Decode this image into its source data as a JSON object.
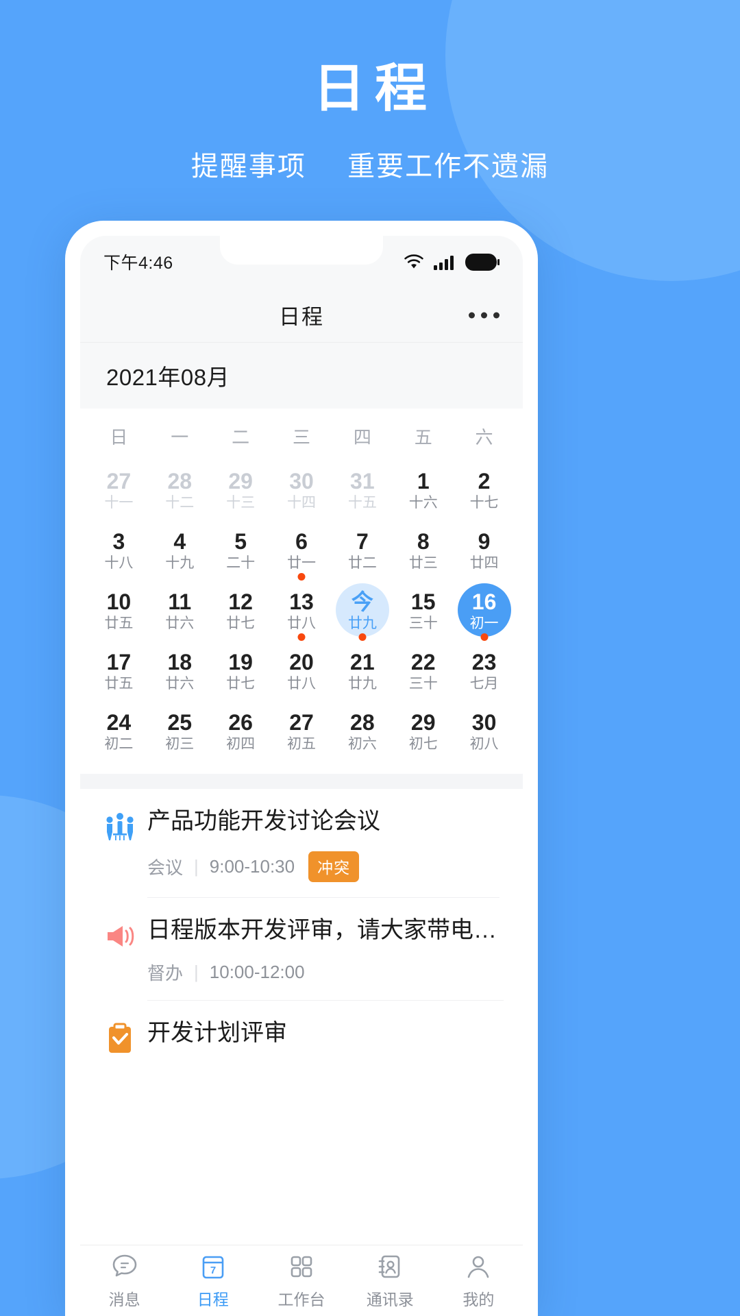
{
  "hero": {
    "title": "日程",
    "subtitle_left": "提醒事项",
    "subtitle_right": "重要工作不遗漏"
  },
  "colors": {
    "brand_blue": "#55A4FB",
    "accent_blue": "#4A9EF5",
    "today_bg": "#D6E9FD",
    "dot_red": "#F8480E",
    "badge_orange": "#F0922B"
  },
  "statusbar": {
    "time": "下午4:46",
    "wifi_icon": "wifi-icon",
    "signal_icon": "cellular-signal-icon",
    "battery_icon": "battery-icon"
  },
  "navbar": {
    "title": "日程",
    "more_icon": "more-horizontal-icon"
  },
  "calendar": {
    "month_label": "2021年08月",
    "weekdays": [
      "日",
      "一",
      "二",
      "三",
      "四",
      "五",
      "六"
    ],
    "weeks": [
      [
        {
          "num": "27",
          "lunar": "十一",
          "muted": true,
          "dot": false
        },
        {
          "num": "28",
          "lunar": "十二",
          "muted": true,
          "dot": false
        },
        {
          "num": "29",
          "lunar": "十三",
          "muted": true,
          "dot": false
        },
        {
          "num": "30",
          "lunar": "十四",
          "muted": true,
          "dot": false
        },
        {
          "num": "31",
          "lunar": "十五",
          "muted": true,
          "dot": false
        },
        {
          "num": "1",
          "lunar": "十六",
          "muted": false,
          "dot": false
        },
        {
          "num": "2",
          "lunar": "十七",
          "muted": false,
          "dot": false
        }
      ],
      [
        {
          "num": "3",
          "lunar": "十八",
          "muted": false,
          "dot": false
        },
        {
          "num": "4",
          "lunar": "十九",
          "muted": false,
          "dot": false
        },
        {
          "num": "5",
          "lunar": "二十",
          "muted": false,
          "dot": false
        },
        {
          "num": "6",
          "lunar": "廿一",
          "muted": false,
          "dot": true
        },
        {
          "num": "7",
          "lunar": "廿二",
          "muted": false,
          "dot": false
        },
        {
          "num": "8",
          "lunar": "廿三",
          "muted": false,
          "dot": false
        },
        {
          "num": "9",
          "lunar": "廿四",
          "muted": false,
          "dot": false
        }
      ],
      [
        {
          "num": "10",
          "lunar": "廿五",
          "muted": false,
          "dot": false
        },
        {
          "num": "11",
          "lunar": "廿六",
          "muted": false,
          "dot": false
        },
        {
          "num": "12",
          "lunar": "廿七",
          "muted": false,
          "dot": false
        },
        {
          "num": "13",
          "lunar": "廿八",
          "muted": false,
          "dot": true
        },
        {
          "num": "今",
          "lunar": "廿九",
          "muted": false,
          "dot": true,
          "today": true
        },
        {
          "num": "15",
          "lunar": "三十",
          "muted": false,
          "dot": false
        },
        {
          "num": "16",
          "lunar": "初一",
          "muted": false,
          "dot": true,
          "selected": true
        }
      ],
      [
        {
          "num": "17",
          "lunar": "廿五",
          "muted": false,
          "dot": false
        },
        {
          "num": "18",
          "lunar": "廿六",
          "muted": false,
          "dot": false
        },
        {
          "num": "19",
          "lunar": "廿七",
          "muted": false,
          "dot": false
        },
        {
          "num": "20",
          "lunar": "廿八",
          "muted": false,
          "dot": false
        },
        {
          "num": "21",
          "lunar": "廿九",
          "muted": false,
          "dot": false
        },
        {
          "num": "22",
          "lunar": "三十",
          "muted": false,
          "dot": false
        },
        {
          "num": "23",
          "lunar": "七月",
          "muted": false,
          "dot": false
        }
      ],
      [
        {
          "num": "24",
          "lunar": "初二",
          "muted": false,
          "dot": false
        },
        {
          "num": "25",
          "lunar": "初三",
          "muted": false,
          "dot": false
        },
        {
          "num": "26",
          "lunar": "初四",
          "muted": false,
          "dot": false
        },
        {
          "num": "27",
          "lunar": "初五",
          "muted": false,
          "dot": false
        },
        {
          "num": "28",
          "lunar": "初六",
          "muted": false,
          "dot": false
        },
        {
          "num": "29",
          "lunar": "初七",
          "muted": false,
          "dot": false
        },
        {
          "num": "30",
          "lunar": "初八",
          "muted": false,
          "dot": false
        }
      ]
    ]
  },
  "events": [
    {
      "icon": "meeting-people-icon",
      "title": "产品功能开发讨论会议",
      "category": "会议",
      "time": "9:00-10:30",
      "badge": "冲突"
    },
    {
      "icon": "megaphone-icon",
      "title": "日程版本开发评审，请大家带电脑…",
      "category": "督办",
      "time": "10:00-12:00",
      "badge": ""
    },
    {
      "icon": "clipboard-check-icon",
      "title": "开发计划评审",
      "category": "",
      "time": "",
      "badge": ""
    }
  ],
  "tabbar": [
    {
      "label": "消息",
      "icon": "chat-bubble-icon",
      "active": false
    },
    {
      "label": "日程",
      "icon": "calendar-icon",
      "active": true,
      "icon_day": "7"
    },
    {
      "label": "工作台",
      "icon": "grid-apps-icon",
      "active": false
    },
    {
      "label": "通讯录",
      "icon": "contacts-icon",
      "active": false
    },
    {
      "label": "我的",
      "icon": "person-icon",
      "active": false
    }
  ]
}
